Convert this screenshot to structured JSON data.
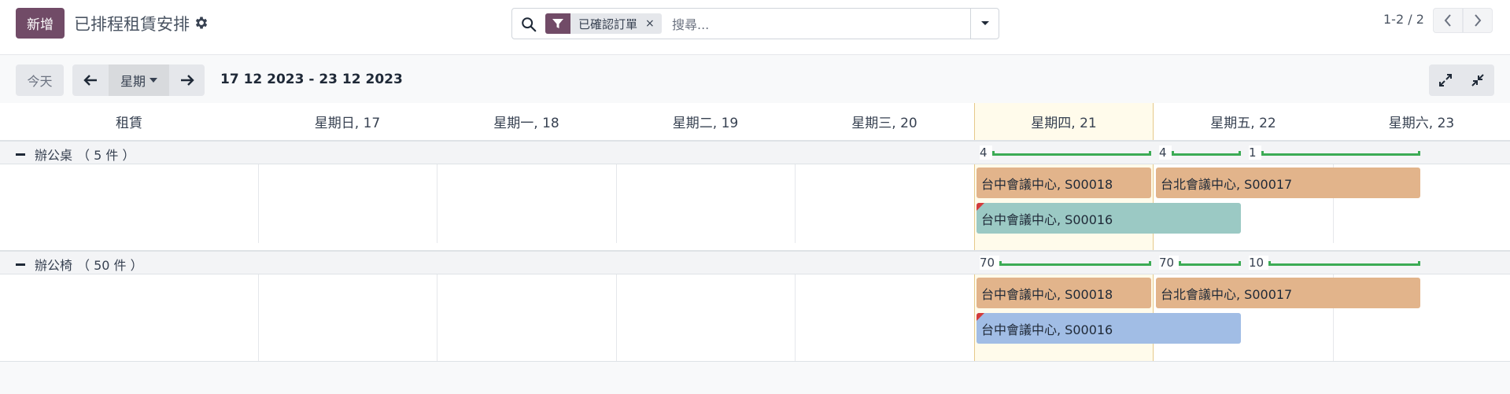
{
  "control_panel": {
    "new_button": "新增",
    "title": "已排程租賃安排",
    "settings_icon": "gear-icon",
    "search": {
      "facet_icon": "filter-icon",
      "facet_label": "已確認訂單",
      "facet_remove": "×",
      "placeholder": "搜尋..."
    },
    "pager": {
      "value": "1-2 / 2"
    }
  },
  "gantt_toolbar": {
    "today_label": "今天",
    "scale_label": "星期",
    "date_range": "17 12 2023 - 23 12 2023"
  },
  "gantt": {
    "row_header_title": "租賃",
    "columns": [
      "星期日, 17",
      "星期一, 18",
      "星期二, 19",
      "星期三, 20",
      "星期四, 21",
      "星期五, 22",
      "星期六, 23"
    ],
    "today_column": "星期四, 21",
    "groups": [
      {
        "name": "辦公桌",
        "count_label": "（ 5 件 ）",
        "aggregates": [
          "4",
          "4",
          "1"
        ],
        "pills": [
          {
            "label": "台中會議中心, S00018",
            "color": "#e2b48b"
          },
          {
            "label": "台北會議中心, S00017",
            "color": "#e2b48b"
          },
          {
            "label": "台中會議中心, S00016",
            "color": "#9bc9c4"
          }
        ]
      },
      {
        "name": "辦公椅",
        "count_label": "（ 50 件 ）",
        "aggregates": [
          "70",
          "70",
          "10"
        ],
        "pills": [
          {
            "label": "台中會議中心, S00018",
            "color": "#e2b48b"
          },
          {
            "label": "台北會議中心, S00017",
            "color": "#e2b48b"
          },
          {
            "label": "台中會議中心, S00016",
            "color": "#a1bde5"
          }
        ]
      }
    ]
  },
  "colors": {
    "brand": "#714b67",
    "today_bg": "#fffbeb",
    "aggregate_line": "#3cab55",
    "late_flag": "#d33b3b"
  }
}
